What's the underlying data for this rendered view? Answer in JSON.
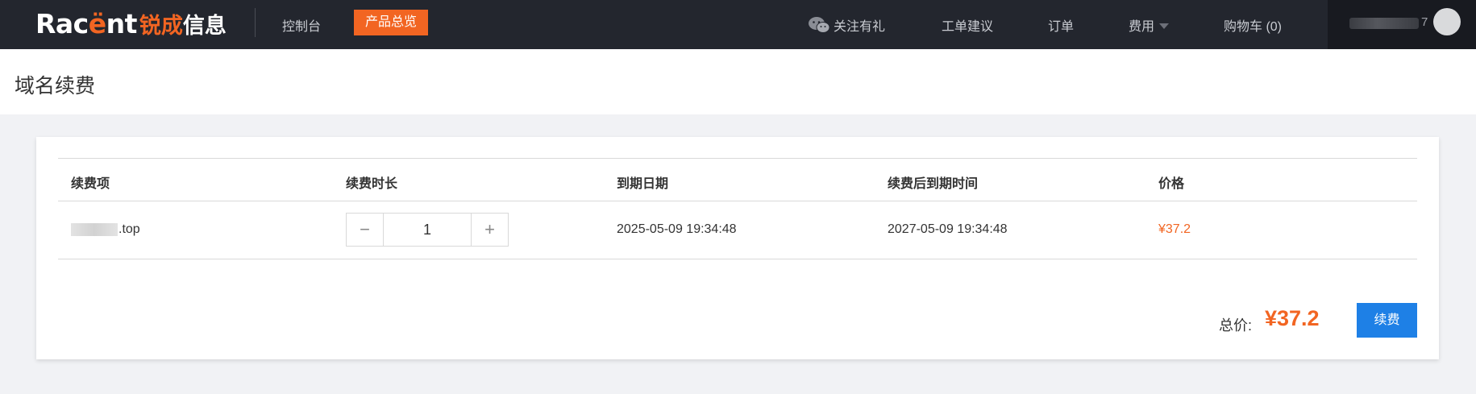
{
  "header": {
    "logo_text_pre": "Rac",
    "logo_text_accent": "ë",
    "logo_text_post": "nt",
    "logo_cn_accent": "锐成",
    "logo_cn_rest": "信息",
    "nav": {
      "console": "控制台",
      "products": "产品总览",
      "follow": "关注有礼",
      "ticket": "工单建议",
      "orders": "订单",
      "fees": "费用",
      "cart": "购物车 (0)"
    },
    "user_tail": "7"
  },
  "page": {
    "title": "域名续费"
  },
  "table": {
    "headers": [
      "续费项",
      "续费时长",
      "到期日期",
      "续费后到期时间",
      "价格"
    ],
    "rows": [
      {
        "domain_suffix": ".top",
        "duration": "1",
        "expire": "2025-05-09 19:34:48",
        "new_expire": "2027-05-09 19:34:48",
        "price": "¥37.2"
      }
    ]
  },
  "summary": {
    "total_label": "总价:",
    "total_value": "¥37.2",
    "renew_button": "续费"
  },
  "colors": {
    "accent": "#f26522",
    "primary": "#1e80e6",
    "topbar": "#23262e"
  },
  "icons": [
    "wechat-icon",
    "caret-down-icon",
    "minus-icon",
    "plus-icon"
  ]
}
